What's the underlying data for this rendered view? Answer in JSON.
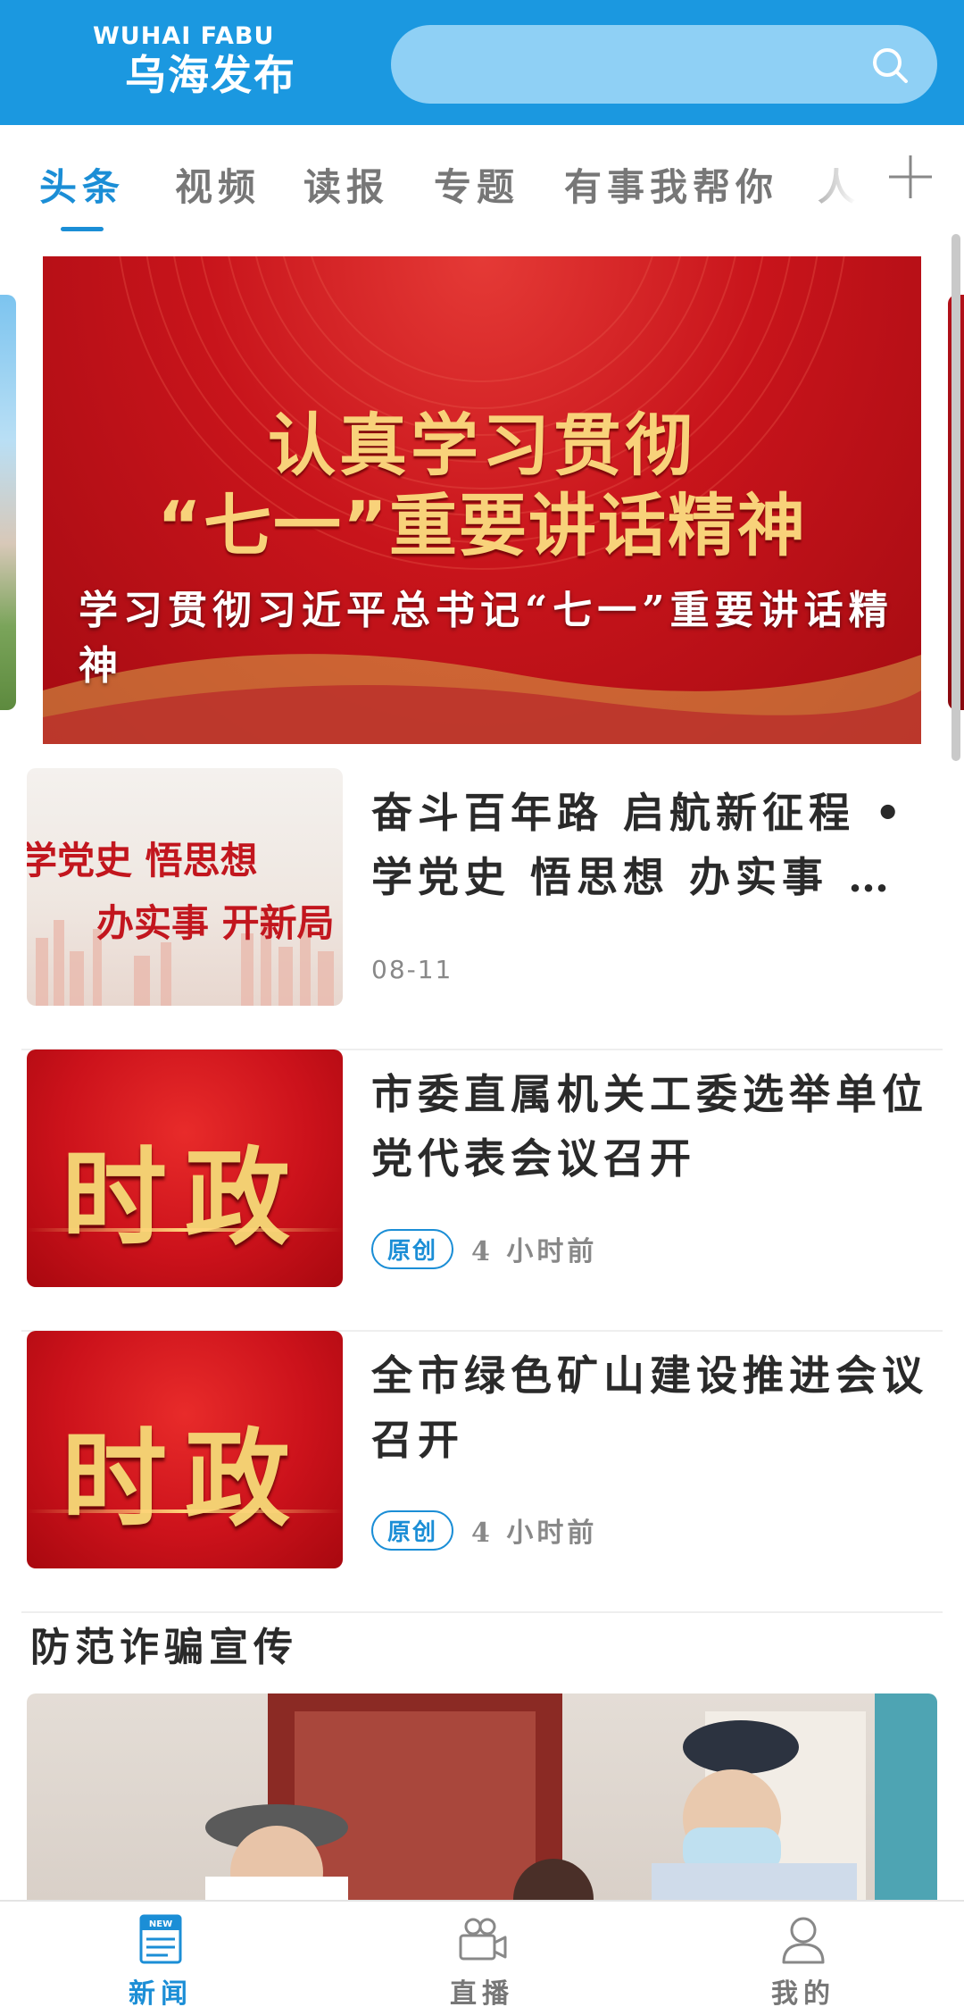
{
  "header": {
    "logo_en": "WUHAI FABU",
    "logo_cn": "乌海发布",
    "search_icon": "search-icon"
  },
  "tabs": [
    {
      "label": "头条",
      "active": true
    },
    {
      "label": "视频"
    },
    {
      "label": "读报"
    },
    {
      "label": "专题"
    },
    {
      "label": "有事我帮你"
    },
    {
      "label": "人"
    }
  ],
  "carousel": {
    "banner_line1": "认真学习贯彻",
    "banner_line2": "“七一”重要讲话精神",
    "caption": "学习贯彻习近平总书记“七一”重要讲话精神"
  },
  "news": [
    {
      "title": "奋斗百年路 启航新征程 • 学党史 悟思想 办实事 …",
      "thumb_text_1": "学党史 悟思想",
      "thumb_text_2": "办实事 开新局",
      "date": "08-11"
    },
    {
      "title": "市委直属机关工委选举单位党代表会议召开",
      "thumb_text": "时政",
      "badge": "原创",
      "time": "4 小时前"
    },
    {
      "title": "全市绿色矿山建设推进会议召开",
      "thumb_text": "时政",
      "badge": "原创",
      "time": "4 小时前"
    }
  ],
  "section": {
    "title": "防范诈骗宣传"
  },
  "bottom_nav": [
    {
      "label": "新闻",
      "icon": "news-icon",
      "icon_text": "NEW",
      "active": true
    },
    {
      "label": "直播",
      "icon": "video-camera-icon"
    },
    {
      "label": "我的",
      "icon": "user-icon"
    }
  ],
  "colors": {
    "brand": "#1b98e0",
    "accent": "#1b8ed6",
    "banner_red": "#c8141b",
    "banner_gold": "#f8d27a"
  }
}
